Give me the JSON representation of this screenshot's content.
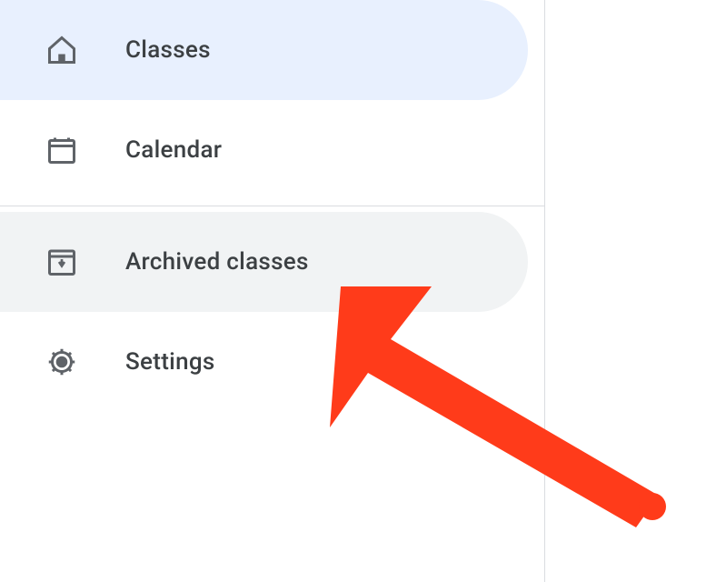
{
  "sidebar": {
    "items": [
      {
        "label": "Classes"
      },
      {
        "label": "Calendar"
      },
      {
        "label": "Archived classes"
      },
      {
        "label": "Settings"
      }
    ]
  },
  "annotation": {
    "target": "archived-classes",
    "arrowColor": "#ff3b1a"
  }
}
